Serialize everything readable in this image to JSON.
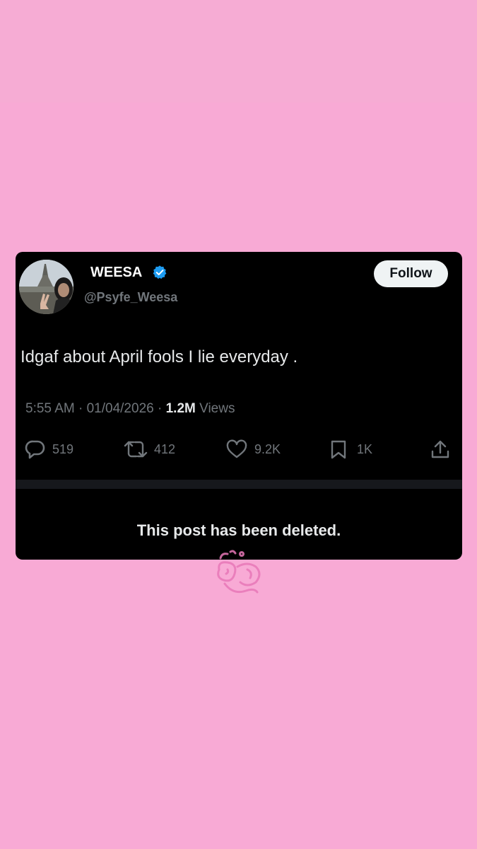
{
  "tweet": {
    "display_name": "WEESA",
    "handle": "@Psyfe_Weesa",
    "follow_label": "Follow",
    "text": "Idgaf about April fools I lie everyday .",
    "time": "5:55 AM",
    "date": "01/04/2026",
    "views_count": "1.2M",
    "views_label": "Views",
    "replies": "519",
    "reposts": "412",
    "likes": "9.2K",
    "bookmarks": "1K",
    "deleted_notice": "This post has been deleted."
  },
  "icons": {
    "verified": "verified-badge-icon",
    "reply": "reply-icon",
    "repost": "repost-icon",
    "like": "heart-icon",
    "bookmark": "bookmark-icon",
    "share": "share-icon"
  },
  "colors": {
    "background": "#f8aad5",
    "card": "#000000",
    "verified_blue": "#1d9bf0",
    "muted_text": "#71767b",
    "follow_button": "#eff3f4"
  }
}
